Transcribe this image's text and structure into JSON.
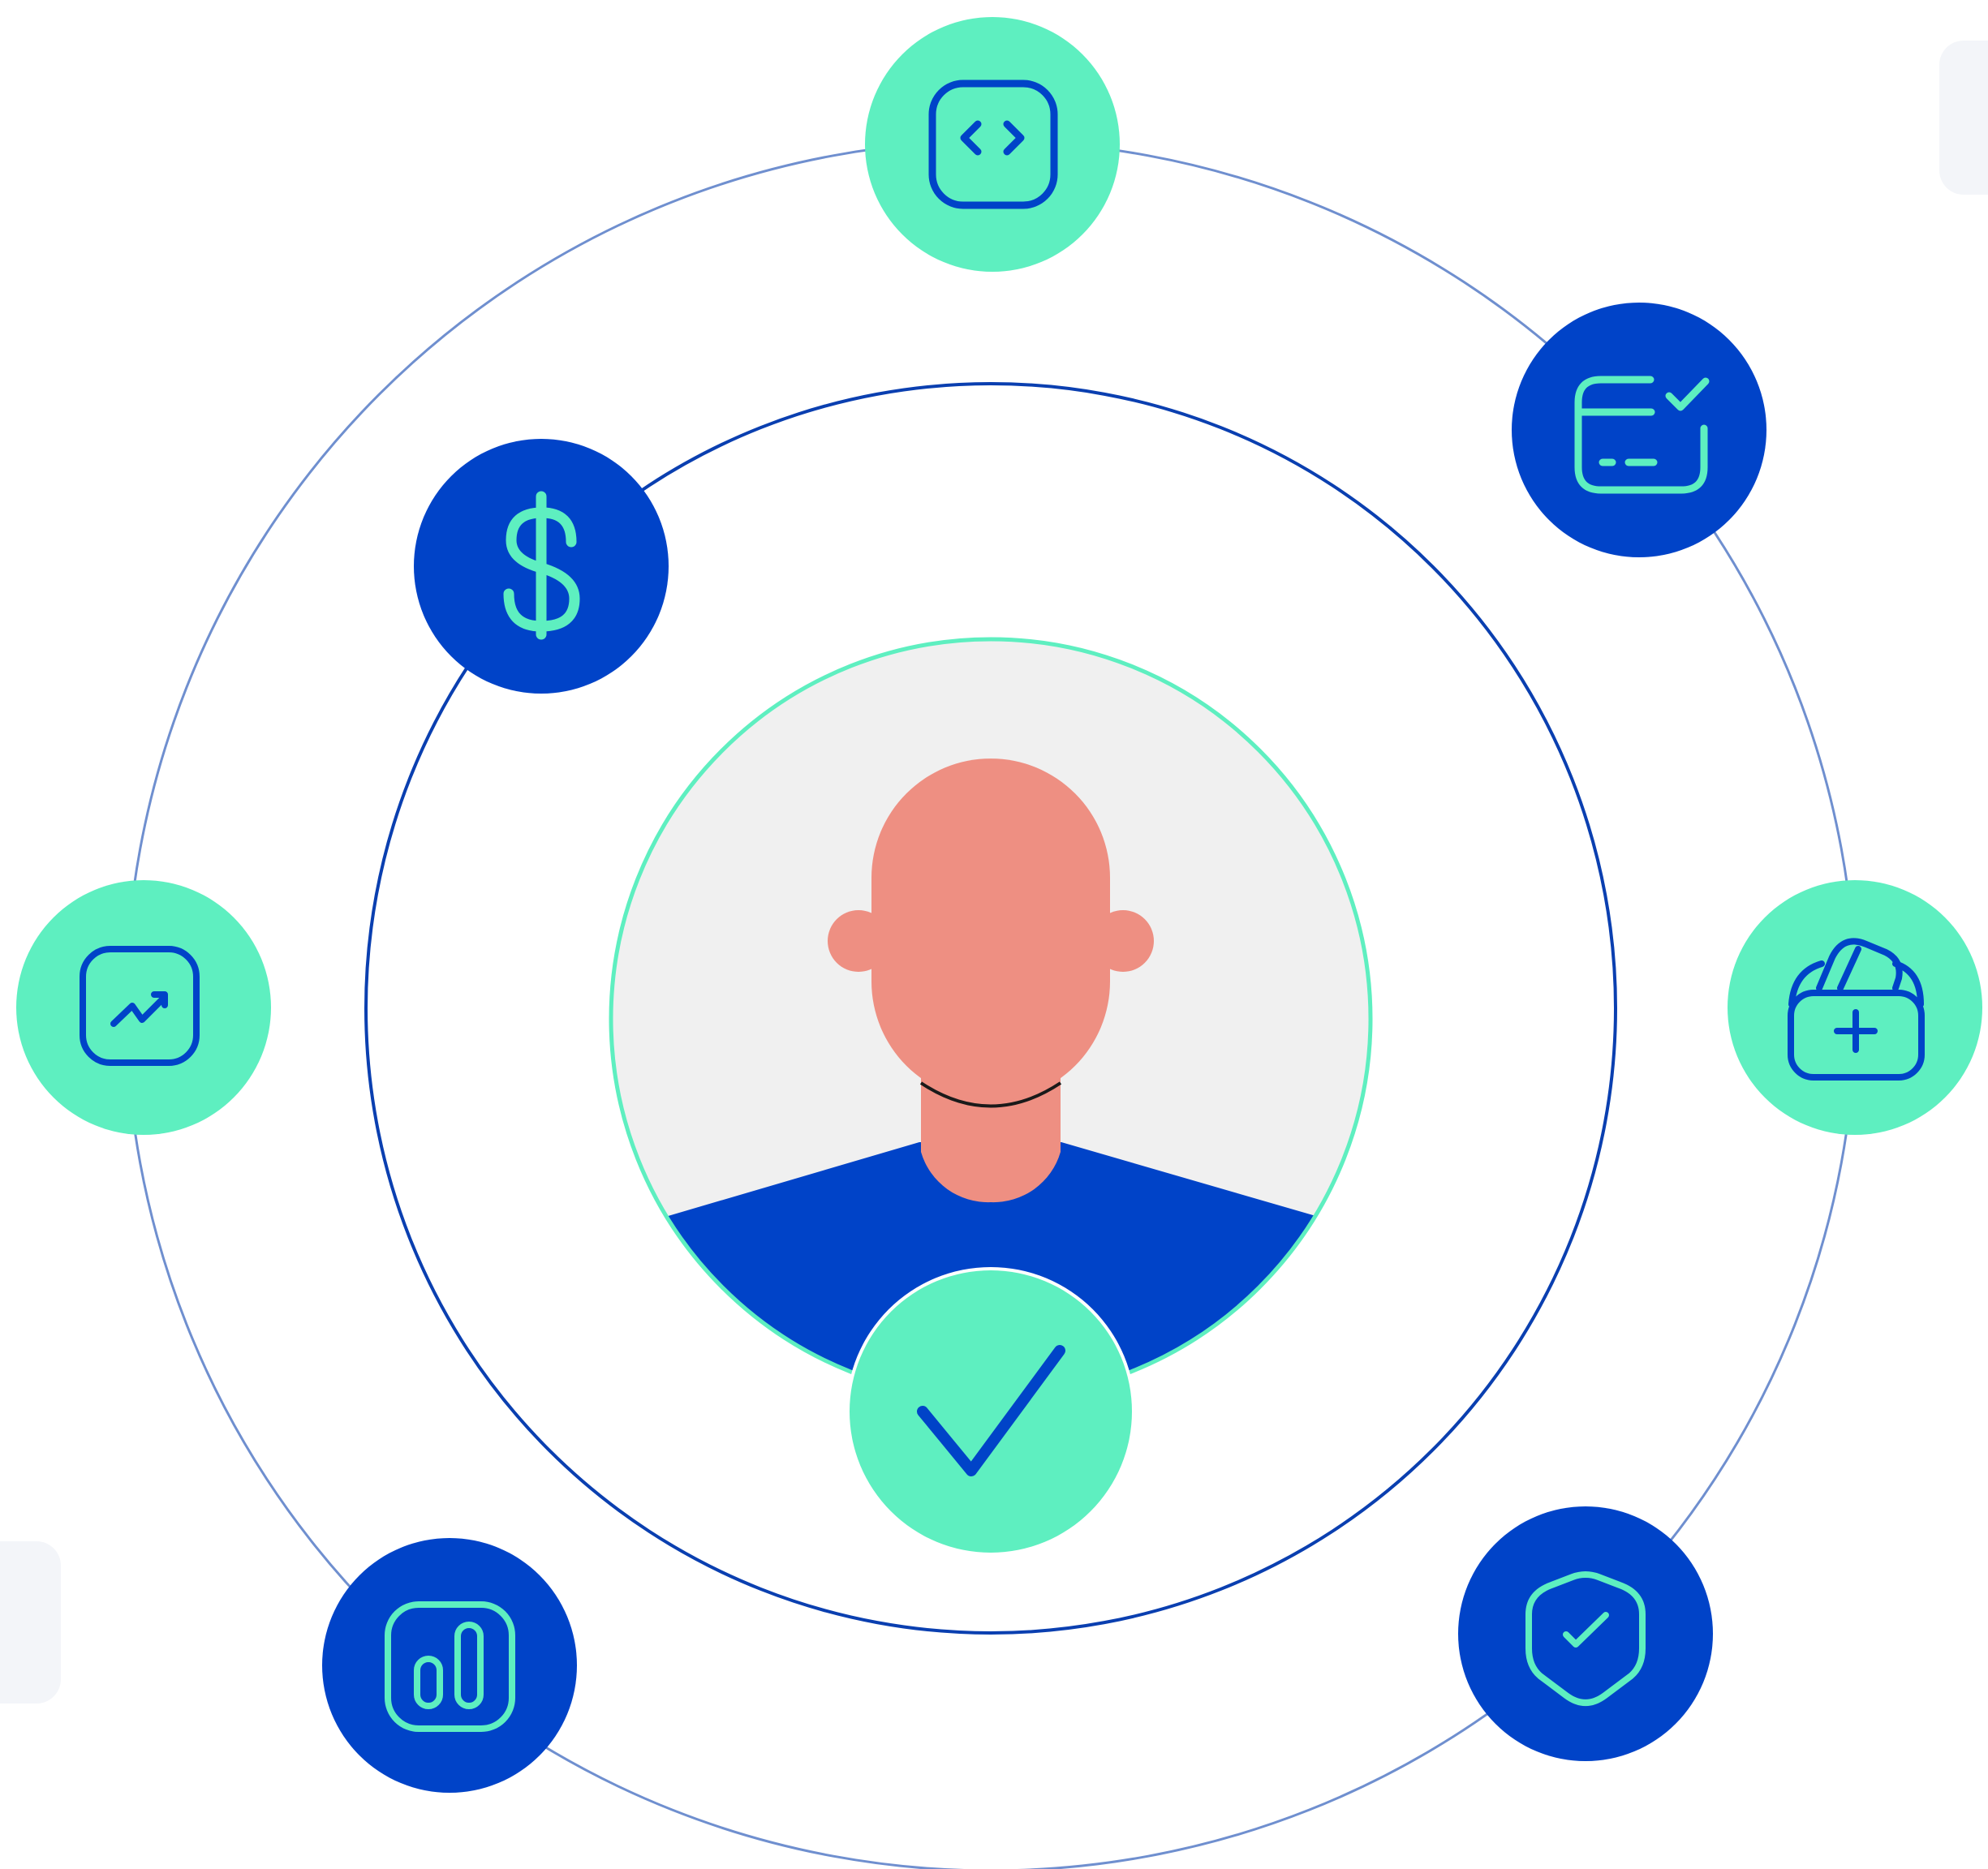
{
  "colors": {
    "background": "#ffffff",
    "mint": "#5eefc0",
    "blue": "#0043c8",
    "skin": "#ee8f82",
    "portrait_bg": "#f0f0f0",
    "outer_ring": "#6f8fcf",
    "inner_ring": "#0a3fb0"
  },
  "orbit_icons": [
    {
      "name": "code-brackets-icon",
      "fill": "mint"
    },
    {
      "name": "credit-card-check-icon",
      "fill": "blue"
    },
    {
      "name": "dollar-sign-icon",
      "fill": "blue"
    },
    {
      "name": "wallet-add-icon",
      "fill": "mint"
    },
    {
      "name": "trend-chart-icon",
      "fill": "mint"
    },
    {
      "name": "shield-check-icon",
      "fill": "blue"
    },
    {
      "name": "bar-chart-icon",
      "fill": "blue"
    }
  ],
  "center": {
    "portrait": "person-avatar",
    "badge": "checkmark-icon"
  }
}
